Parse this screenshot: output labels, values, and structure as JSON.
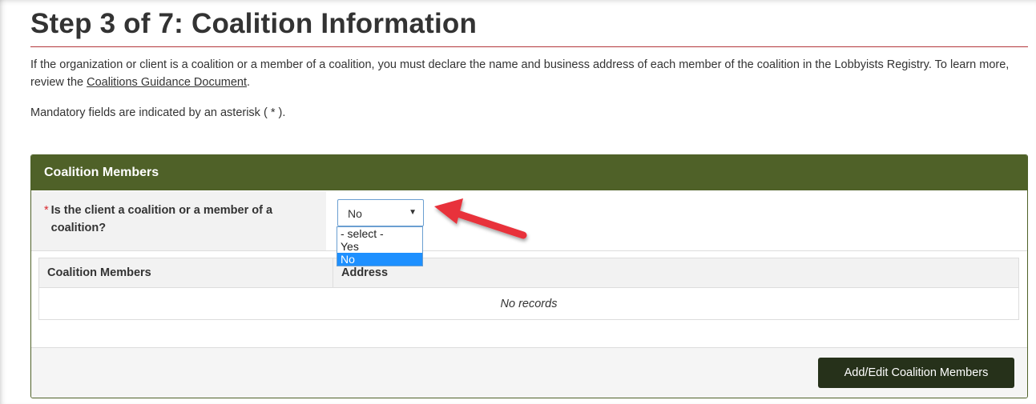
{
  "page": {
    "title": "Step 3 of 7: Coalition Information",
    "intro_before_link": "If the organization or client is a coalition or a member of a coalition, you must declare the name and business address of each member of the coalition in the Lobbyists Registry. To learn more, review the ",
    "intro_link": "Coalitions Guidance Document",
    "intro_after_link": ".",
    "mandatory_note": "Mandatory fields are indicated by an asterisk ( * )."
  },
  "panel": {
    "heading": "Coalition Members",
    "question": {
      "required_mark": "*",
      "label": "Is the client a coalition or a member of a coalition?",
      "selected_value": "No",
      "options": [
        "- select -",
        "Yes",
        "No"
      ]
    },
    "table": {
      "columns": [
        "Coalition Members",
        "Address"
      ],
      "empty_message": "No records"
    },
    "add_button_label": "Add/Edit Coalition Members"
  },
  "colors": {
    "panel_green": "#4f6128",
    "button_dark": "#26311a",
    "title_rule": "#b4373c",
    "highlight_blue": "#1e90ff",
    "annotation_arrow": "#e8303a"
  },
  "icons": {
    "dropdown_caret": "caret-down-icon",
    "annotation": "red-arrow-icon"
  }
}
